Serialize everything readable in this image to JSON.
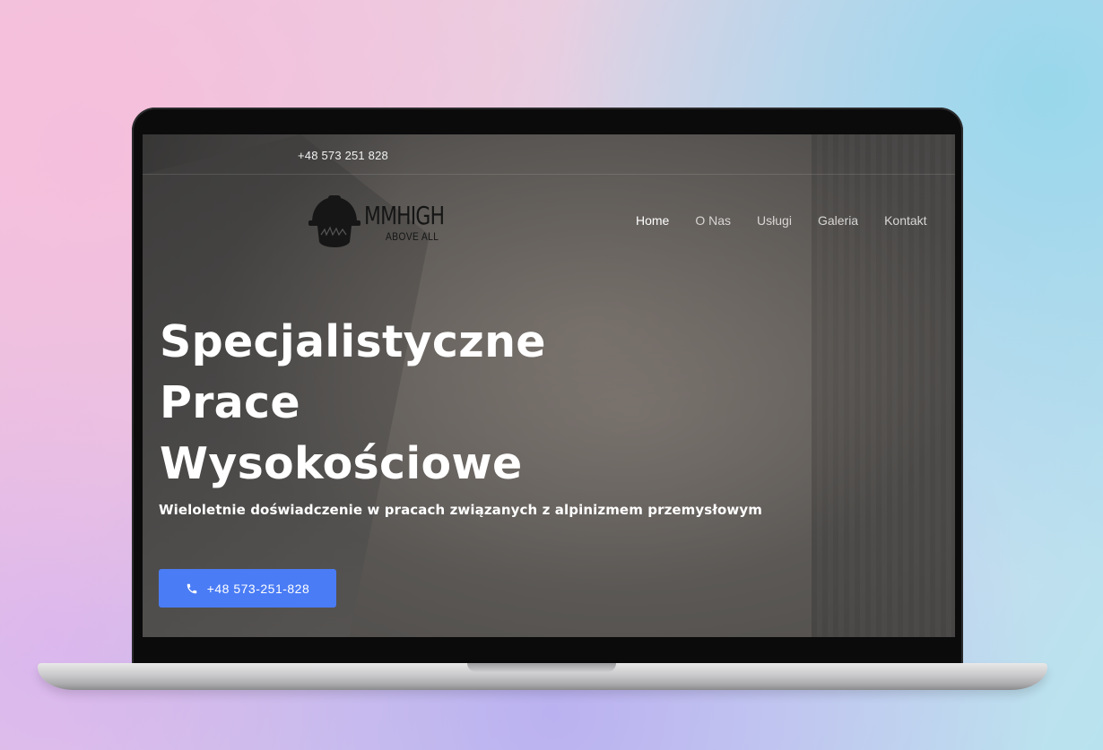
{
  "topbar": {
    "phone": "+48 573 251 828"
  },
  "logo": {
    "name": "MMHIGH",
    "tagline": "ABOVE ALL",
    "icon": "helmet-icon"
  },
  "nav": {
    "items": [
      {
        "label": "Home",
        "active": true
      },
      {
        "label": "O Nas",
        "active": false
      },
      {
        "label": "Usługi",
        "active": false
      },
      {
        "label": "Galeria",
        "active": false
      },
      {
        "label": "Kontakt",
        "active": false
      }
    ]
  },
  "hero": {
    "title_lines": [
      "Specjalistyczne",
      "Prace",
      "Wysokościowe"
    ],
    "subtitle": "Wieloletnie doświadczenie w pracach związanych z alpinizmem przemysłowym",
    "cta_label": "+48 573-251-828",
    "cta_icon": "phone-icon"
  },
  "colors": {
    "cta": "#4a7cf5",
    "text": "#ffffff"
  }
}
